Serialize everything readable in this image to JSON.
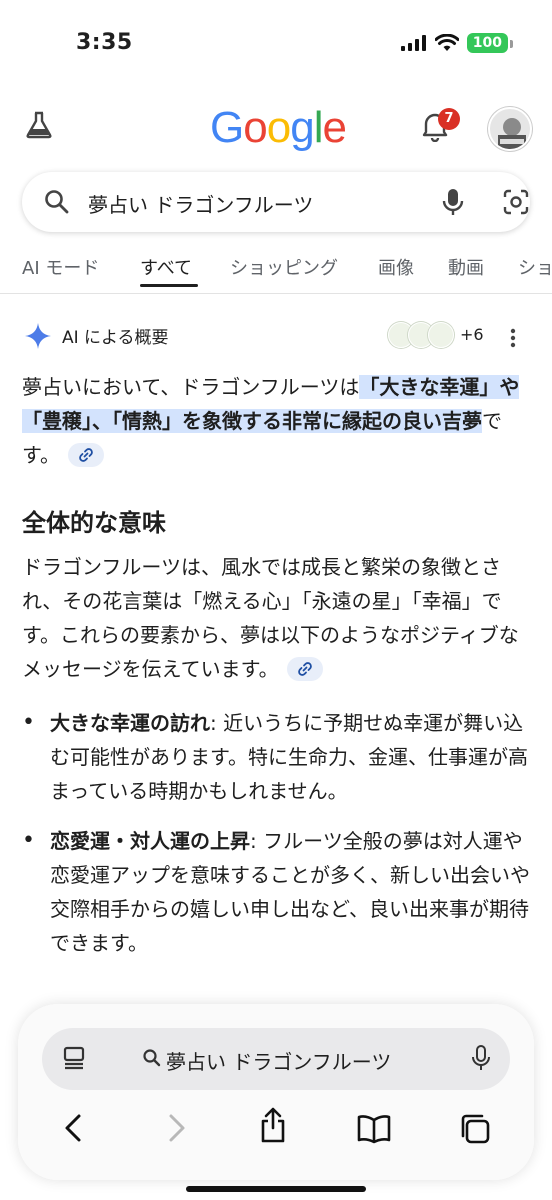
{
  "status": {
    "time": "3:35",
    "battery": "100"
  },
  "header": {
    "logo": [
      {
        "ch": "G",
        "color": "#4285F4"
      },
      {
        "ch": "o",
        "color": "#EA4335"
      },
      {
        "ch": "o",
        "color": "#FBBC05"
      },
      {
        "ch": "g",
        "color": "#4285F4"
      },
      {
        "ch": "l",
        "color": "#34A853"
      },
      {
        "ch": "e",
        "color": "#EA4335"
      }
    ],
    "notifications": "7"
  },
  "search": {
    "query": "夢占い ドラゴンフルーツ"
  },
  "tabs": [
    "AI モード",
    "すべて",
    "ショッピング",
    "画像",
    "動画",
    "ショ"
  ],
  "ai": {
    "title": "AI による概要",
    "sources_more": "+6",
    "intro_plain": "夢占いにおいて、ドラゴンフルーツは",
    "intro_hl": "「大きな幸運」や「豊穣」、「情熱」を象徴する非常に縁起の良い吉夢",
    "intro_end": "です。",
    "section_title": "全体的な意味",
    "para": "ドラゴンフルーツは、風水では成長と繁栄の象徴とされ、その花言葉は「燃える心」「永遠の星」「幸福」です。これらの要素から、夢は以下のようなポジティブなメッセージを伝えています。",
    "bullets": [
      {
        "title": "大きな幸運の訪れ",
        "text": ": 近いうちに予期せぬ幸運が舞い込む可能性があります。特に生命力、金運、仕事運が高まっている時期かもしれません。"
      },
      {
        "title": "恋愛運・対人運の上昇",
        "text": ": フルーツ全般の夢は対人運や恋愛運アップを意味することが多く、新しい出会いや交際相手からの嬉しい申し出など、良い出来事が期待できます。"
      }
    ]
  },
  "bottom": {
    "address": "夢占い ドラゴンフルーツ"
  }
}
